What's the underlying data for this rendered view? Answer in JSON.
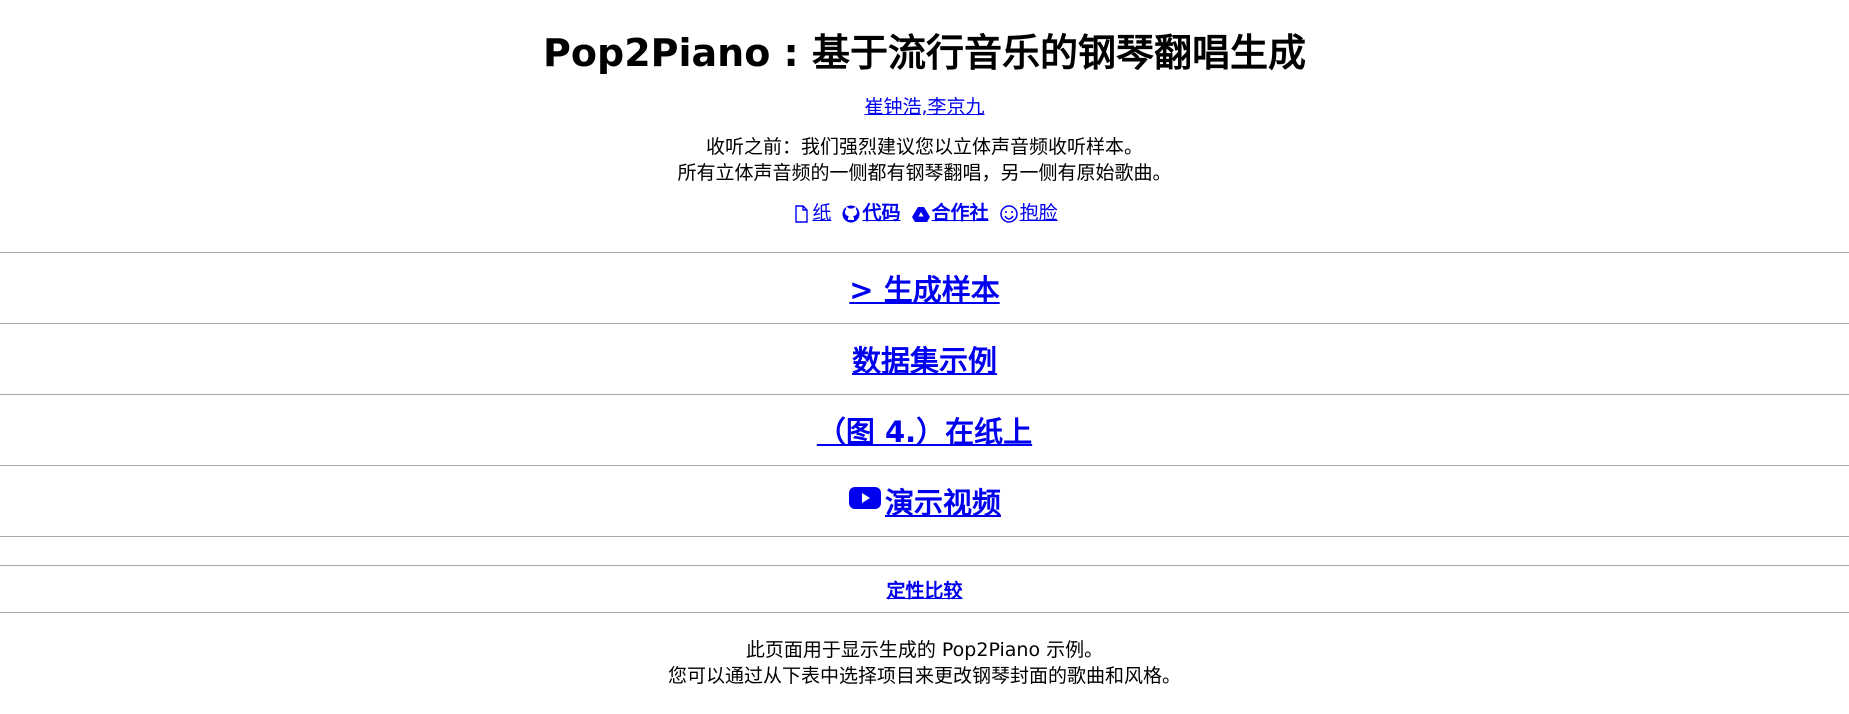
{
  "header": {
    "title": "Pop2Piano : 基于流行音乐的钢琴翻唱生成",
    "authors_label": "崔钟浩,李京九"
  },
  "note": {
    "line1": "收听之前：我们强烈建议您以立体声音频收听样本。",
    "line2": "所有立体声音频的一侧都有钢琴翻唱，另一侧有原始歌曲。"
  },
  "links": {
    "paper_label": "纸",
    "code_label": "代码",
    "colab_label": "合作社",
    "huggingface_label": "抱脸"
  },
  "sections": {
    "samples_label": "> 生成样本",
    "dataset_label": "数据集示例",
    "figure_label": "（图 4.）在纸上",
    "video_label": "演示视频",
    "qualitative_label": "定性比较"
  },
  "description": {
    "line1": "此页面用于显示生成的 Pop2Piano 示例。",
    "line2": "您可以通过从下表中选择项目来更改钢琴封面的歌曲和风格。"
  },
  "colors": {
    "link": "#0000ee",
    "separator": "#a9a9a9",
    "text": "#000000"
  }
}
